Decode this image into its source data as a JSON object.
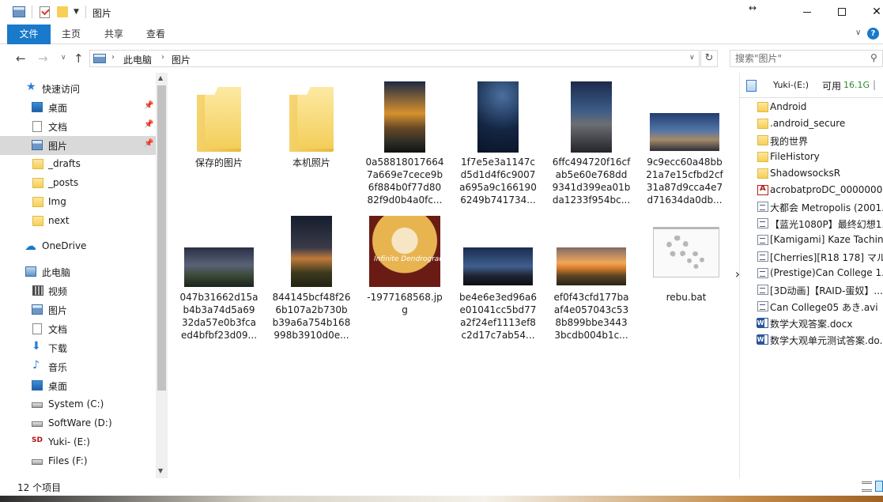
{
  "window": {
    "title": "图片",
    "resize_glyph": "↔"
  },
  "ribbon": {
    "tabs": [
      "文件",
      "主页",
      "共享",
      "查看"
    ],
    "help": "?"
  },
  "address": {
    "crumbs": [
      "此电脑",
      "图片"
    ],
    "search_placeholder": "搜索\"图片\""
  },
  "nav": {
    "quick_access": "快速访问",
    "items": [
      {
        "label": "桌面",
        "icon": "desktop-icon",
        "pinned": true
      },
      {
        "label": "文档",
        "icon": "document-icon",
        "pinned": true
      },
      {
        "label": "图片",
        "icon": "pictures-icon",
        "pinned": true,
        "selected": true
      },
      {
        "label": "_drafts",
        "icon": "folder-icon"
      },
      {
        "label": "_posts",
        "icon": "folder-icon"
      },
      {
        "label": "Img",
        "icon": "folder-icon"
      },
      {
        "label": "next",
        "icon": "folder-icon"
      }
    ],
    "onedrive": "OneDrive",
    "this_pc": "此电脑",
    "pc_items": [
      {
        "label": "视频",
        "icon": "video-icon"
      },
      {
        "label": "图片",
        "icon": "pictures-icon"
      },
      {
        "label": "文档",
        "icon": "document-icon"
      },
      {
        "label": "下载",
        "icon": "download-icon"
      },
      {
        "label": "音乐",
        "icon": "music-icon"
      },
      {
        "label": "桌面",
        "icon": "desktop-icon"
      },
      {
        "label": "System (C:)",
        "icon": "drive-icon"
      },
      {
        "label": "SoftWare (D:)",
        "icon": "drive-icon"
      },
      {
        "label": "Yuki- (E:)",
        "icon": "sd-card-icon"
      },
      {
        "label": "Files (F:)",
        "icon": "drive-icon"
      }
    ]
  },
  "files": [
    {
      "name": "保存的图片",
      "kind": "folder"
    },
    {
      "name": "本机照片",
      "kind": "folder"
    },
    {
      "name": "0a58818017664\n7a669e7cece9b\n6f884b0f77d80\n82f9d0b4a0fc...",
      "kind": "image"
    },
    {
      "name": "1f7e5e3a1147c\nd5d1d4f6c9007\na695a9c166190\n6249b741734...",
      "kind": "image"
    },
    {
      "name": "6ffc494720f16cf\nab5e60e768dd\n9341d399ea01b\nda1233f954bc...",
      "kind": "image"
    },
    {
      "name": "9c9ecc60a48bb\n21a7e15cfbd2cf\n31a87d9cca4e7\nd71634da0db...",
      "kind": "image"
    },
    {
      "name": "047b31662d15a\nb4b3a74d5a69\n32da57e0b3fca\ned4bfbf23d09...",
      "kind": "image"
    },
    {
      "name": "844145bcf48f26\n6b107a2b730b\nb39a6a754b168\n998b3910d0e...",
      "kind": "image"
    },
    {
      "name": "-1977168568.jp\ng",
      "kind": "image",
      "overlay_text": "Infinite Dendrogram"
    },
    {
      "name": "be4e6e3ed96a6\ne01041cc5bd77\na2f24ef1113ef8\nc2d17c7ab54...",
      "kind": "image"
    },
    {
      "name": "ef0f43cfd177ba\naf4e057043c53\n8b899bbe3443\n3bcdb004b1c...",
      "kind": "image"
    },
    {
      "name": "rebu.bat",
      "kind": "batch"
    }
  ],
  "preview": {
    "drive": "Yuki-(E:)",
    "free_label": "可用",
    "free_value": "16.1G",
    "items": [
      {
        "label": "Android",
        "kind": "folder"
      },
      {
        "label": ".android_secure",
        "kind": "folder"
      },
      {
        "label": "我的世界",
        "kind": "folder"
      },
      {
        "label": "FileHistory",
        "kind": "folder"
      },
      {
        "label": "ShadowsocksR",
        "kind": "folder"
      },
      {
        "label": "acrobatproDC_0000000...",
        "kind": "pdf"
      },
      {
        "label": "大都会 Metropolis (2001...",
        "kind": "file"
      },
      {
        "label": "【蓝光1080P】最终幻想1...",
        "kind": "file"
      },
      {
        "label": "[Kamigami] Kaze Tachin...",
        "kind": "file"
      },
      {
        "label": "[Cherries][R18 178] マル...",
        "kind": "file"
      },
      {
        "label": "(Prestige)Can College 1...",
        "kind": "file"
      },
      {
        "label": "[3D动画]【RAID-蛋奴】...",
        "kind": "file"
      },
      {
        "label": "Can College05 あき.avi",
        "kind": "file"
      },
      {
        "label": "数学大观答案.docx",
        "kind": "word"
      },
      {
        "label": "数学大观单元测试答案.do...",
        "kind": "word"
      }
    ]
  },
  "status": {
    "count": "12 个项目"
  }
}
